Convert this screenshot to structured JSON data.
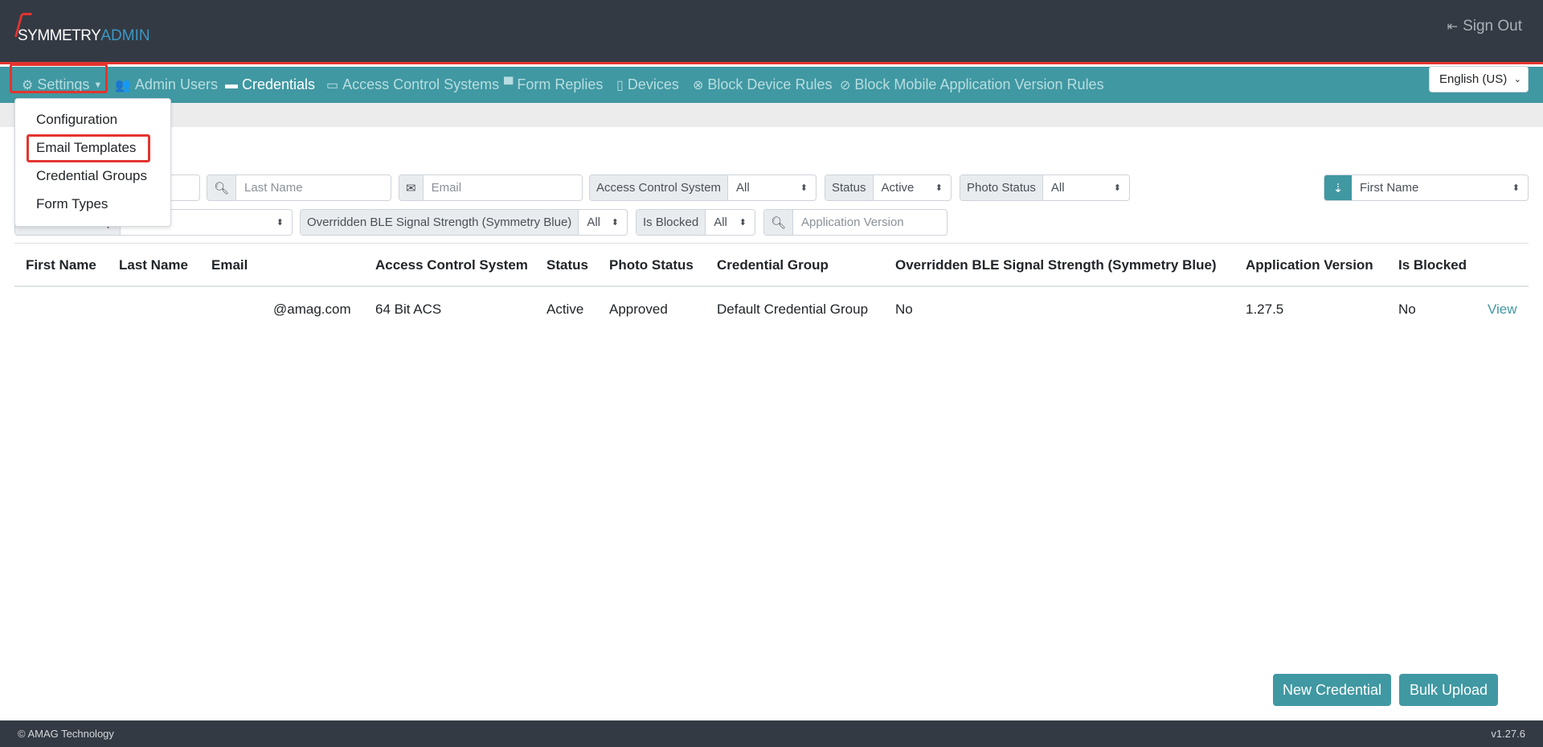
{
  "header": {
    "logo_text_1": "SYMMETRY",
    "logo_text_2": "ADMIN",
    "sign_out": "Sign Out"
  },
  "nav": {
    "items": [
      {
        "label": "Settings",
        "icon": "gear-icon"
      },
      {
        "label": "Admin Users",
        "icon": "users-icon"
      },
      {
        "label": "Credentials",
        "icon": "id-card-icon"
      },
      {
        "label": "Access Control Systems",
        "icon": "laptop-icon"
      },
      {
        "label": "Form Replies",
        "icon": "comment-icon"
      },
      {
        "label": "Devices",
        "icon": "mobile-icon"
      },
      {
        "label": "Block Device Rules",
        "icon": "times-circle-icon"
      },
      {
        "label": "Block Mobile Application Version Rules",
        "icon": "ban-icon"
      }
    ],
    "active": "Credentials",
    "language": "English (US)"
  },
  "settings_menu": [
    "Configuration",
    "Email Templates",
    "Credential Groups",
    "Form Types"
  ],
  "filters": {
    "last_name_placeholder": "Last Name",
    "email_placeholder": "Email",
    "acs_label": "Access Control System",
    "acs_value": "All",
    "status_label": "Status",
    "status_value": "Active",
    "photo_status_label": "Photo Status",
    "photo_status_value": "All",
    "sort_value": "First Name",
    "credential_group_label": "Credential Group",
    "credential_group_value": "All",
    "ble_label": "Overridden BLE Signal Strength (Symmetry Blue)",
    "ble_value": "All",
    "is_blocked_label": "Is Blocked",
    "is_blocked_value": "All",
    "app_version_placeholder": "Application Version"
  },
  "table": {
    "headers": [
      "First Name",
      "Last Name",
      "Email",
      "Access Control System",
      "Status",
      "Photo Status",
      "Credential Group",
      "Overridden BLE Signal Strength (Symmetry Blue)",
      "Application Version",
      "Is Blocked"
    ],
    "rows": [
      {
        "first_name": "",
        "last_name": "",
        "email": "@amag.com",
        "acs": "64 Bit ACS",
        "status": "Active",
        "photo_status": "Approved",
        "credential_group": "Default Credential Group",
        "ble": "No",
        "app_version": "1.27.5",
        "is_blocked": "No",
        "action": "View"
      }
    ]
  },
  "buttons": {
    "new_credential": "New Credential",
    "bulk_upload": "Bulk Upload"
  },
  "footer": {
    "copyright": "© AMAG Technology",
    "version": "v1.27.6"
  },
  "colors": {
    "teal": "#4098a2",
    "dark": "#343a43",
    "highlight": "#e3342f"
  }
}
